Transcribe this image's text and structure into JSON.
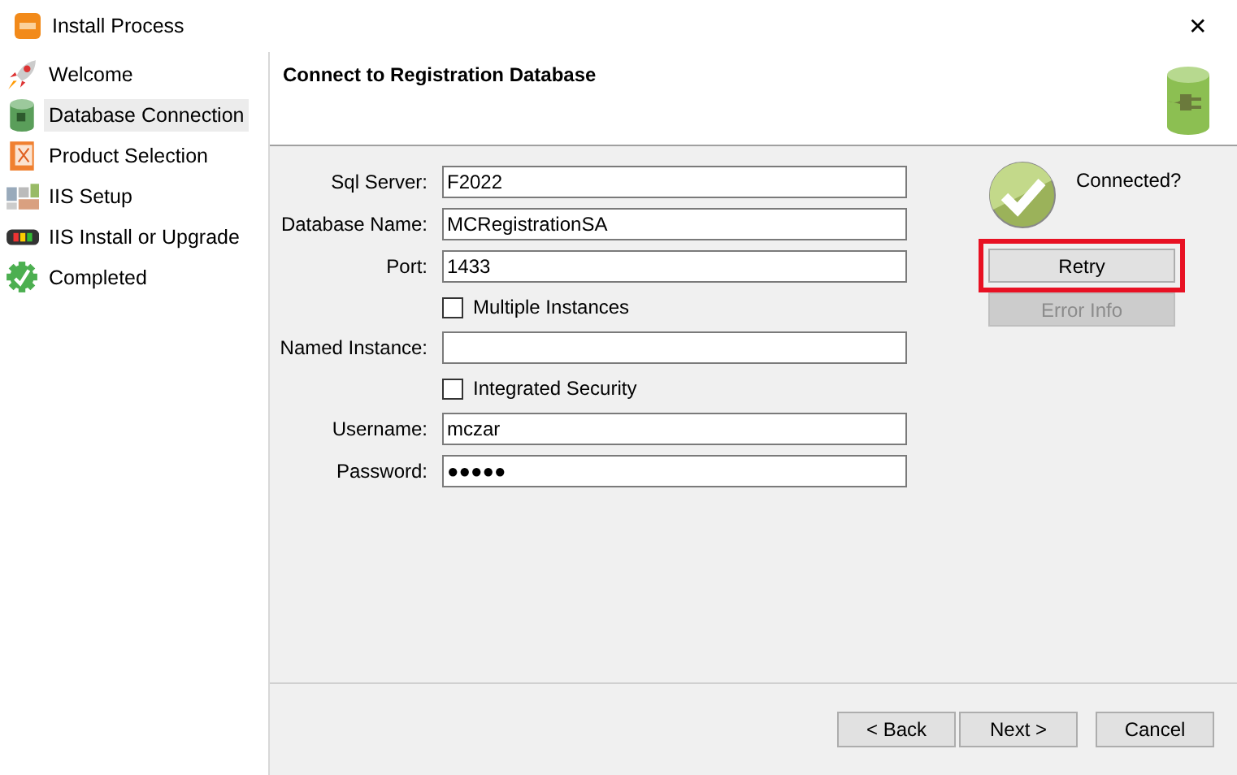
{
  "window": {
    "title": "Install Process",
    "close": "✕"
  },
  "sidebar": {
    "items": [
      {
        "label": "Welcome",
        "selected": false
      },
      {
        "label": "Database Connection",
        "selected": true
      },
      {
        "label": "Product Selection",
        "selected": false
      },
      {
        "label": "IIS Setup",
        "selected": false
      },
      {
        "label": "IIS Install or Upgrade",
        "selected": false
      },
      {
        "label": "Completed",
        "selected": false
      }
    ]
  },
  "header": {
    "title": "Connect to Registration Database"
  },
  "form": {
    "rows": [
      {
        "kind": "field",
        "label": "Sql Server:",
        "value": "F2022"
      },
      {
        "kind": "field",
        "label": "Database Name:",
        "value": "MCRegistrationSA"
      },
      {
        "kind": "field",
        "label": "Port:",
        "value": "1433"
      },
      {
        "kind": "checkbox",
        "label": "Multiple Instances",
        "checked": false
      },
      {
        "kind": "field",
        "label": "Named Instance:"
      },
      {
        "kind": "checkbox",
        "label": "Integrated Security",
        "checked": false
      },
      {
        "kind": "field",
        "label": "Username:",
        "value": "mczar"
      },
      {
        "kind": "field",
        "label": "Password:",
        "value": "●●●●●"
      }
    ]
  },
  "status": {
    "label": "Connected?",
    "connected": true
  },
  "side_buttons": [
    {
      "label": "Retry",
      "disabled": false,
      "highlighted": true
    },
    {
      "label": "Error Info",
      "disabled": true,
      "highlighted": false
    }
  ],
  "footer_buttons": [
    {
      "label": "< Back"
    },
    {
      "label": "Next >"
    },
    {
      "label": "Cancel"
    }
  ]
}
